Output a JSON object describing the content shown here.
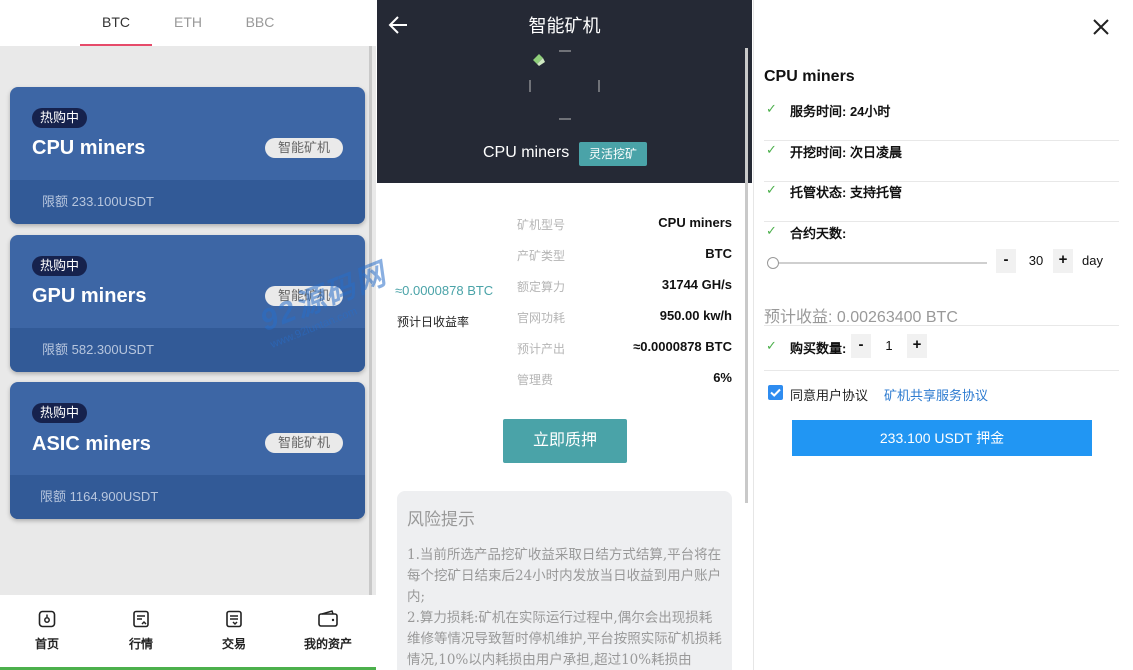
{
  "left": {
    "coin_tabs": [
      {
        "label": "BTC",
        "active": true
      },
      {
        "label": "ETH",
        "active": false
      },
      {
        "label": "BBC",
        "active": false
      }
    ],
    "cards": [
      {
        "hot": "热购中",
        "name": "CPU miners",
        "tag": "智能矿机",
        "limit": "限额 233.100USDT"
      },
      {
        "hot": "热购中",
        "name": "GPU miners",
        "tag": "智能矿机",
        "limit": "限额 582.300USDT"
      },
      {
        "hot": "热购中",
        "name": "ASIC miners",
        "tag": "智能矿机",
        "limit": "限额 1164.900USDT"
      }
    ],
    "nav": [
      {
        "label": "首页",
        "icon": "home-icon"
      },
      {
        "label": "行情",
        "icon": "market-icon"
      },
      {
        "label": "交易",
        "icon": "trade-icon"
      },
      {
        "label": "我的资产",
        "icon": "wallet-icon"
      }
    ]
  },
  "mid": {
    "title": "智能矿机",
    "miner_name": "CPU miners",
    "flex_tag": "灵活挖矿",
    "specs": [
      {
        "label": "矿机型号",
        "value": "CPU miners"
      },
      {
        "label": "产矿类型",
        "value": "BTC"
      },
      {
        "label": "额定算力",
        "value": "31744 GH/s"
      },
      {
        "label": "官网功耗",
        "value": "950.00 kw/h"
      },
      {
        "label": "预计产出",
        "value": "≈0.0000878 BTC"
      },
      {
        "label": "管理费",
        "value": "6%"
      }
    ],
    "daily_value": "≈0.0000878 BTC",
    "daily_label": "预计日收益率",
    "pledge_button": "立即质押",
    "risk_title": "风险提示",
    "risk_text": "1.当前所选产品挖矿收益采取日结方式结算,平台将在每个挖矿日结束后24小时内发放当日收益到用户账户内;\n2.算力损耗:矿机在实际运行过程中,偶尔会出现损耗维修等情况导致暂时停机维护,平台按照实际矿机损耗情况,10%以内耗损由用户承担,超过10%耗损由"
  },
  "right": {
    "title": "CPU miners",
    "rows": [
      {
        "check": "✓",
        "text": "服务时间:  24小时"
      },
      {
        "check": "✓",
        "text": "开挖时间:  次日凌晨"
      },
      {
        "check": "✓",
        "text": "托管状态:  支持托管"
      },
      {
        "check": "✓",
        "text": "合约天数:"
      }
    ],
    "days_value": "30",
    "days_unit": "day",
    "expected": "预计收益: 0.00263400 BTC",
    "buy_check": "✓",
    "buy_label": "购买数量:",
    "buy_value": "1",
    "minus": "-",
    "plus": "+",
    "agree_text": "同意用户协议",
    "agree_link": "矿机共享服务协议",
    "pay_button": "233.100 USDT 押金"
  },
  "watermark": {
    "big": "92源码网",
    "small": "www.92luntan.com"
  },
  "colors": {
    "card": "#3d66a5",
    "accent_teal": "#4aa3a8",
    "pay_blue": "#2196f3",
    "tab_underline": "#e64b6a"
  }
}
